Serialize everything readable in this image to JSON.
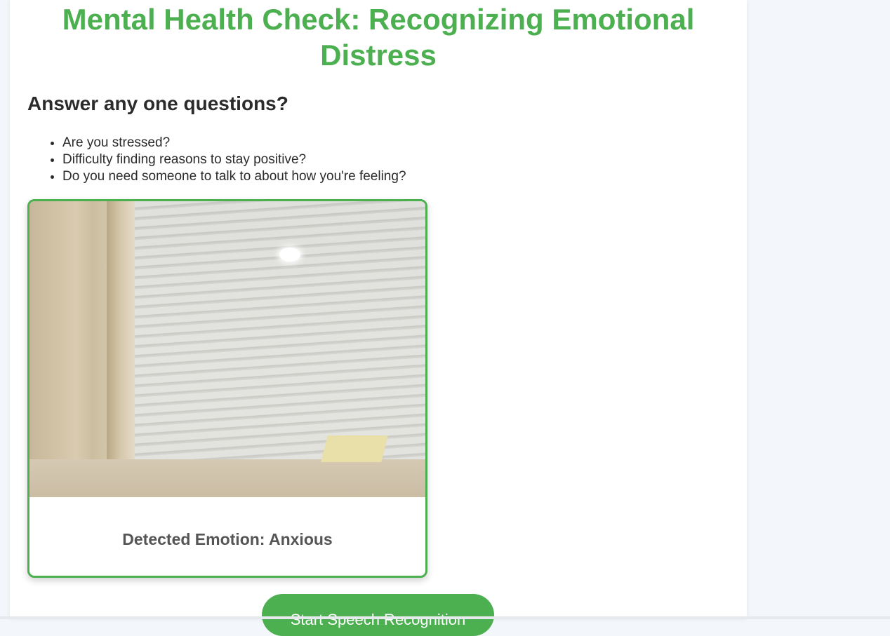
{
  "header": {
    "title": "Mental Health Check: Recognizing Emotional Distress"
  },
  "prompt": {
    "heading": "Answer any one questions?",
    "questions": [
      "Are you stressed?",
      "Difficulty finding reasons to stay positive?",
      "Do you need someone to talk to about how you're feeling?"
    ]
  },
  "camera": {
    "emotion_text": "Detected Emotion: Anxious"
  },
  "actions": {
    "speech_button_label": "Start Speech Recognition"
  },
  "colors": {
    "accent": "#4caf50",
    "text": "#2b2b2b",
    "muted_text": "#555555",
    "background": "#f3f6fa"
  }
}
